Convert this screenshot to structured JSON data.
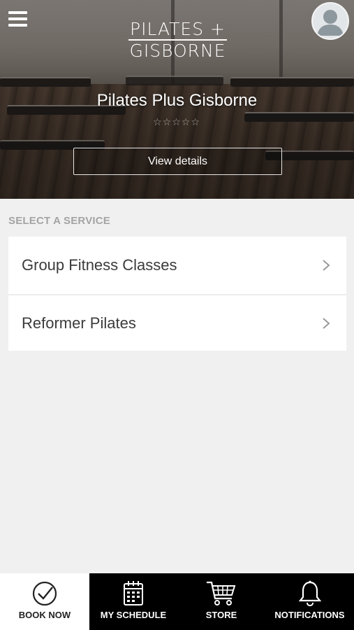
{
  "header": {
    "menu_icon": "hamburger-menu-icon",
    "logo": {
      "line1": "PILATES +",
      "line2": "GISBORNE"
    },
    "avatar_icon": "user-avatar-icon"
  },
  "studio": {
    "name": "Pilates Plus Gisborne",
    "rating_stars": "☆☆☆☆☆",
    "rating_value": 0,
    "rating_max": 5,
    "view_details_label": "View details"
  },
  "services": {
    "heading": "SELECT A SERVICE",
    "items": [
      {
        "label": "Group Fitness Classes",
        "icon": "chevron-right-icon"
      },
      {
        "label": "Reformer Pilates",
        "icon": "chevron-right-icon"
      }
    ]
  },
  "bottom_nav": {
    "items": [
      {
        "label": "BOOK NOW",
        "icon": "check-circle-icon",
        "active": true
      },
      {
        "label": "MY SCHEDULE",
        "icon": "calendar-icon",
        "active": false
      },
      {
        "label": "STORE",
        "icon": "cart-icon",
        "active": false
      },
      {
        "label": "NOTIFICATIONS",
        "icon": "bell-icon",
        "active": false
      }
    ]
  },
  "colors": {
    "page_background": "#f0f0f0",
    "card_background": "#ffffff",
    "nav_background": "#000000",
    "nav_active_background": "#ffffff",
    "heading_text": "#a4a4a4",
    "item_text": "#3b3b3b"
  }
}
